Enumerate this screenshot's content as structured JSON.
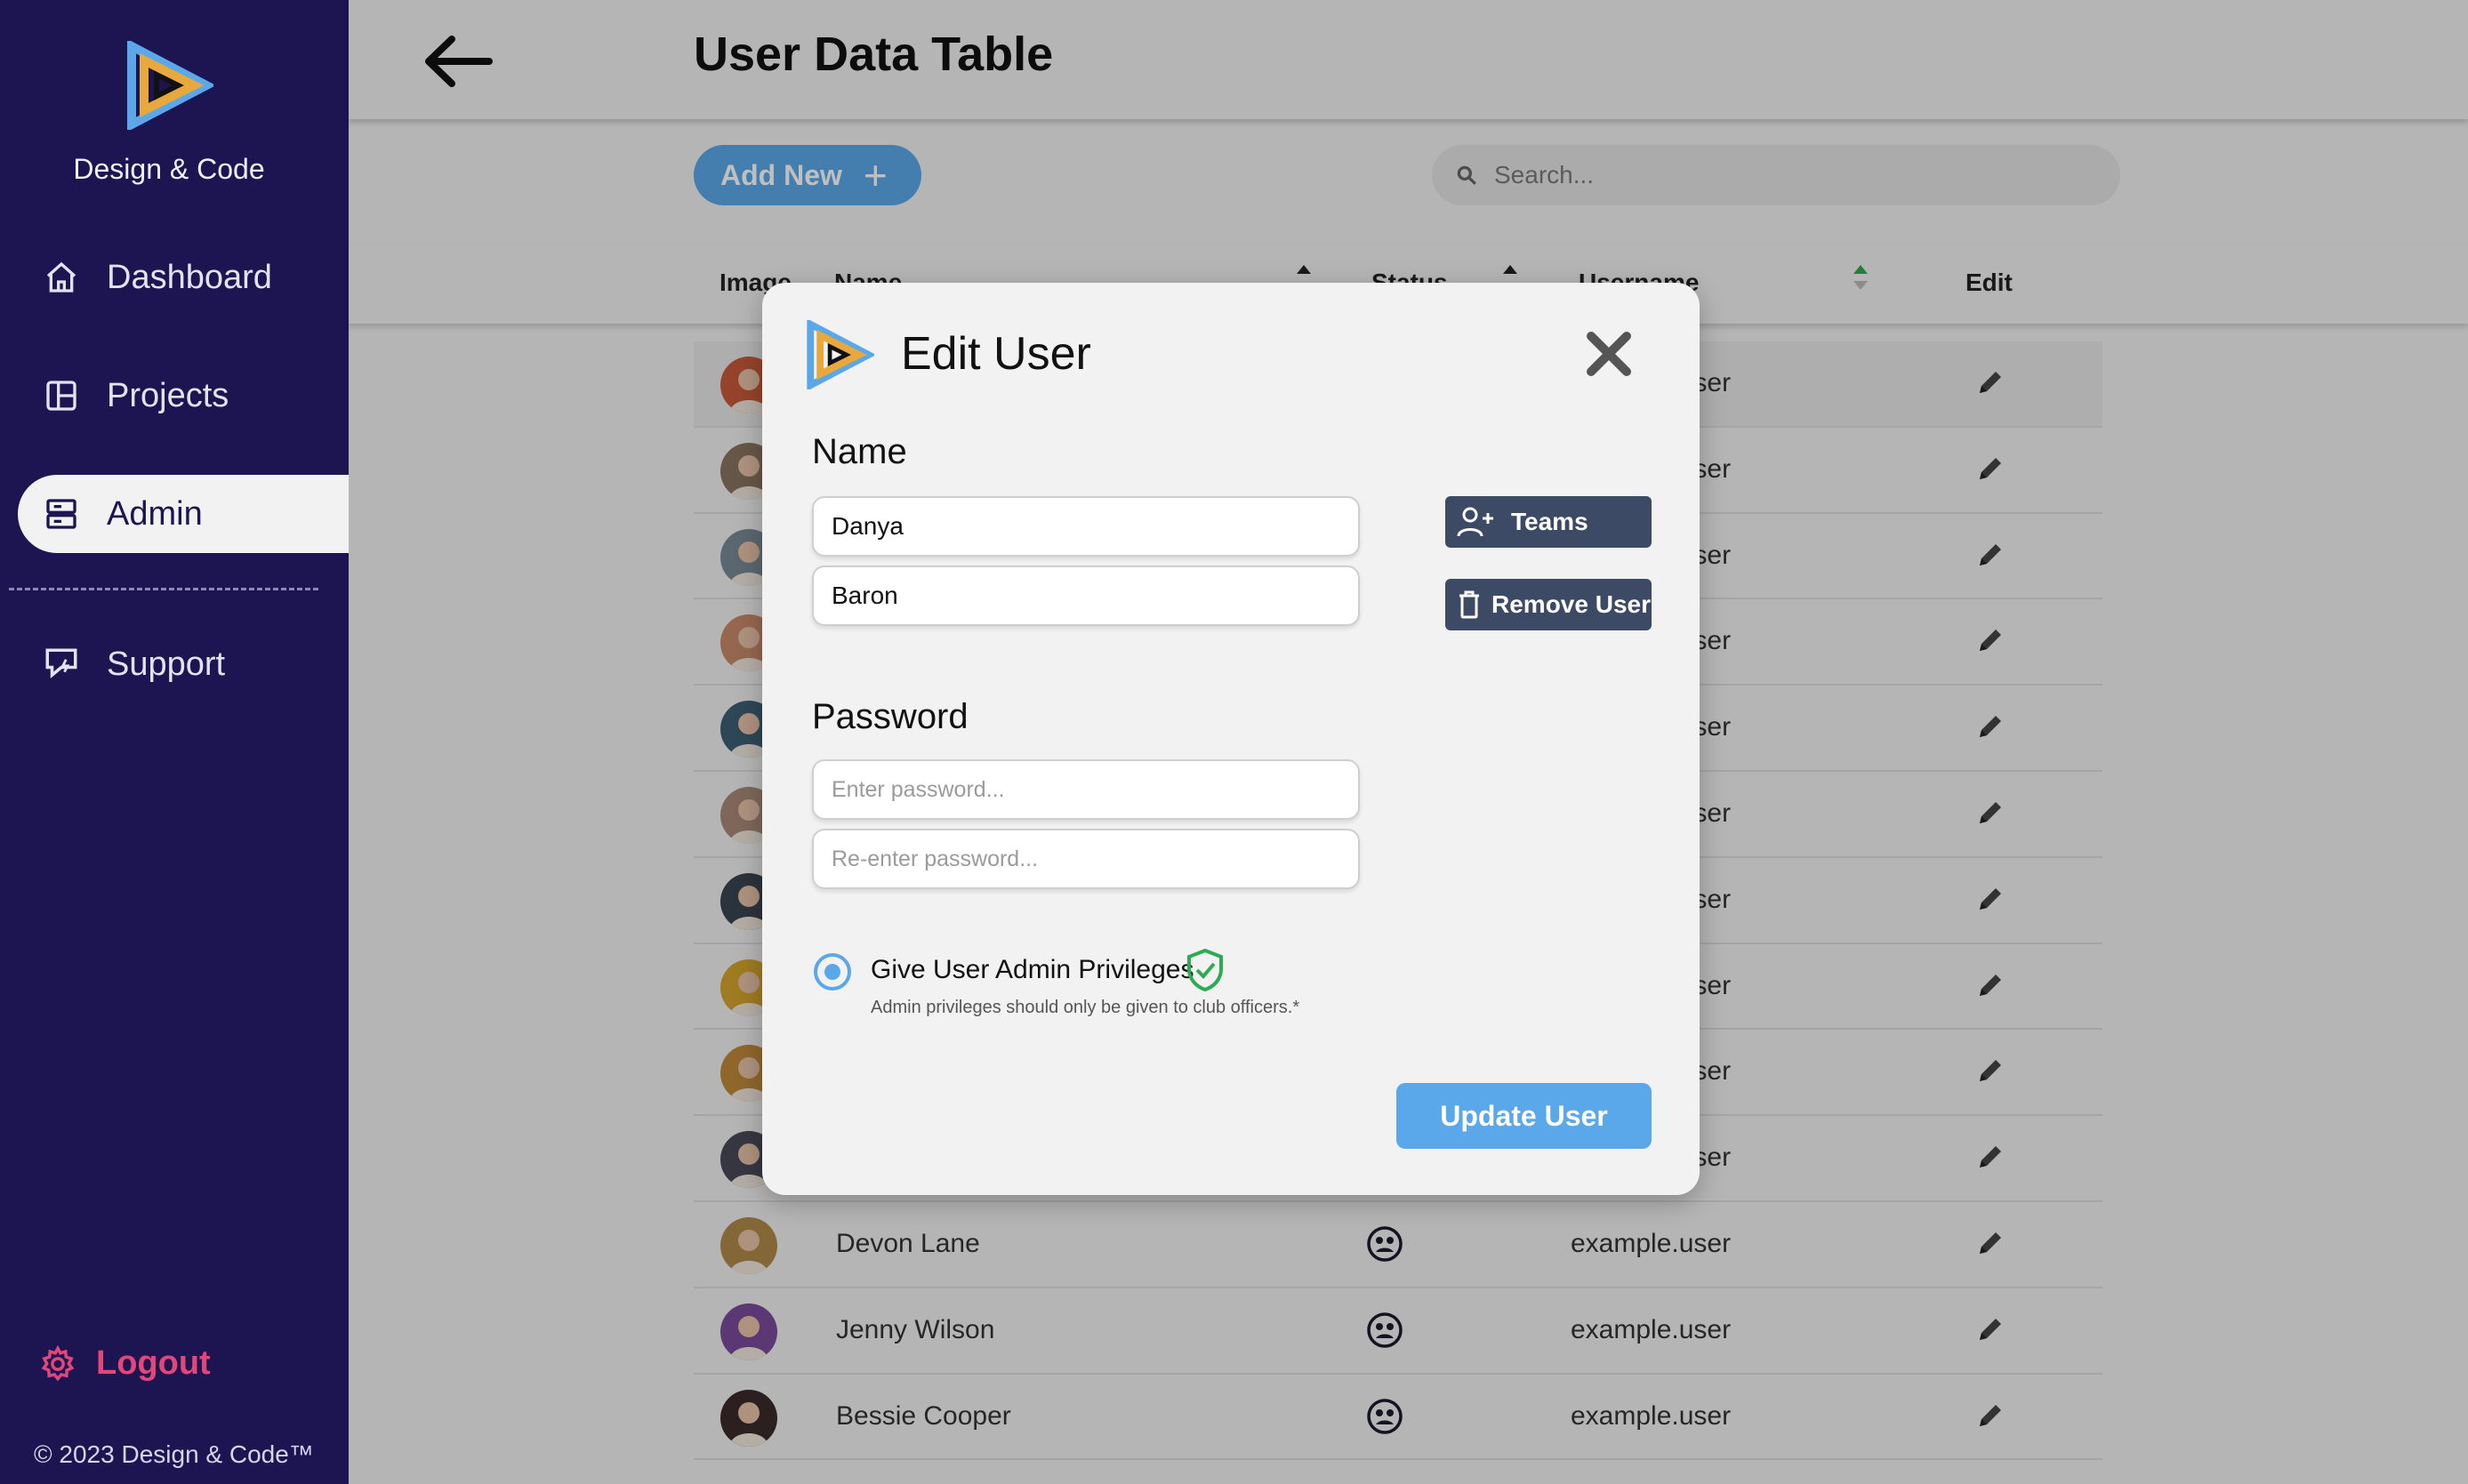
{
  "sidebar": {
    "brand_name": "Design & Code",
    "nav": [
      {
        "label": "Dashboard",
        "icon": "home-icon"
      },
      {
        "label": "Projects",
        "icon": "layout-icon"
      },
      {
        "label": "Admin",
        "icon": "server-icon",
        "active": true
      },
      {
        "label": "Support",
        "icon": "chat-support-icon"
      }
    ],
    "logout_label": "Logout",
    "copyright": "© 2023 Design & Code™"
  },
  "header": {
    "title": "User Data Table"
  },
  "toolbar": {
    "add_label": "Add New",
    "add_symbol": "+",
    "search_placeholder": "Search..."
  },
  "table": {
    "columns": {
      "image": "Image",
      "name": "Name",
      "status": "Status",
      "username": "Username",
      "edit": "Edit"
    },
    "rows": [
      {
        "name": "",
        "username": "example.user"
      },
      {
        "name": "",
        "username": "example.user"
      },
      {
        "name": "",
        "username": "example.user"
      },
      {
        "name": "",
        "username": "example.user"
      },
      {
        "name": "",
        "username": "example.user"
      },
      {
        "name": "",
        "username": "example.user"
      },
      {
        "name": "",
        "username": "example.user"
      },
      {
        "name": "",
        "username": "example.user"
      },
      {
        "name": "",
        "username": "example.user"
      },
      {
        "name": "",
        "username": "example.user"
      },
      {
        "name": "Devon Lane",
        "username": "example.user"
      },
      {
        "name": "Jenny Wilson",
        "username": "example.user"
      },
      {
        "name": "Bessie Cooper",
        "username": "example.user"
      }
    ]
  },
  "modal": {
    "title": "Edit User",
    "name_label": "Name",
    "first_name": "Danya",
    "last_name": "Baron",
    "teams_label": "Teams",
    "remove_label": "Remove User",
    "password_label": "Password",
    "password_placeholder": "Enter password...",
    "password_confirm_placeholder": "Re-enter password...",
    "admin_label": "Give User Admin Privileges",
    "admin_selected": true,
    "admin_note": "Admin privileges should only be given to club officers.*",
    "update_label": "Update User"
  },
  "colors": {
    "sidebar_bg": "#1c1552",
    "accent_blue": "#5aa8ea",
    "logout_pink": "#e2477a",
    "dark_button": "#3d4a66",
    "shield_green": "#2eaa4f"
  }
}
